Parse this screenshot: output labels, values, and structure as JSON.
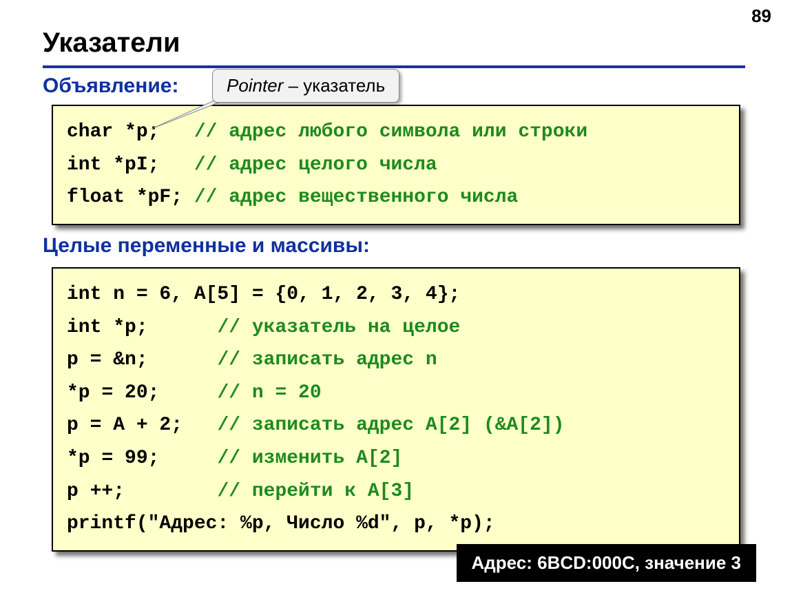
{
  "page_number": "89",
  "title": "Указатели",
  "callout": {
    "italic": "Pointer",
    "rest": " – указатель"
  },
  "section1_label": "Объявление:",
  "section2_label": "Целые переменные и массивы:",
  "code1": {
    "l1_code": "char *p;   ",
    "l1_cmt": "// адрес любого символа или строки",
    "l2_code": "int *pI;   ",
    "l2_cmt": "// адрес целого числа",
    "l3_code": "float *pF; ",
    "l3_cmt": "// адрес вещественного числа"
  },
  "code2": {
    "l1_code": "int n = 6, A[5] = {0, 1, 2, 3, 4};",
    "l1_cmt": "",
    "l2_code": "int *p;      ",
    "l2_cmt": "// указатель на целое",
    "l3_code": "p = &n;      ",
    "l3_cmt": "// записать адрес n",
    "l4_code": "*p = 20;     ",
    "l4_cmt": "// n = 20",
    "l5_code": "p = A + 2;   ",
    "l5_cmt": "// записать адрес A[2] (&A[2])",
    "l6_code": "*p = 99;     ",
    "l6_cmt": "// изменить A[2]",
    "l7_code": "p ++;        ",
    "l7_cmt": "// перейти к A[3]",
    "l8_code": "printf(\"Адрес: %p, Число %d\", p, *p);",
    "l8_cmt": ""
  },
  "output": "Адрес: 6BCD:000C, значение 3"
}
